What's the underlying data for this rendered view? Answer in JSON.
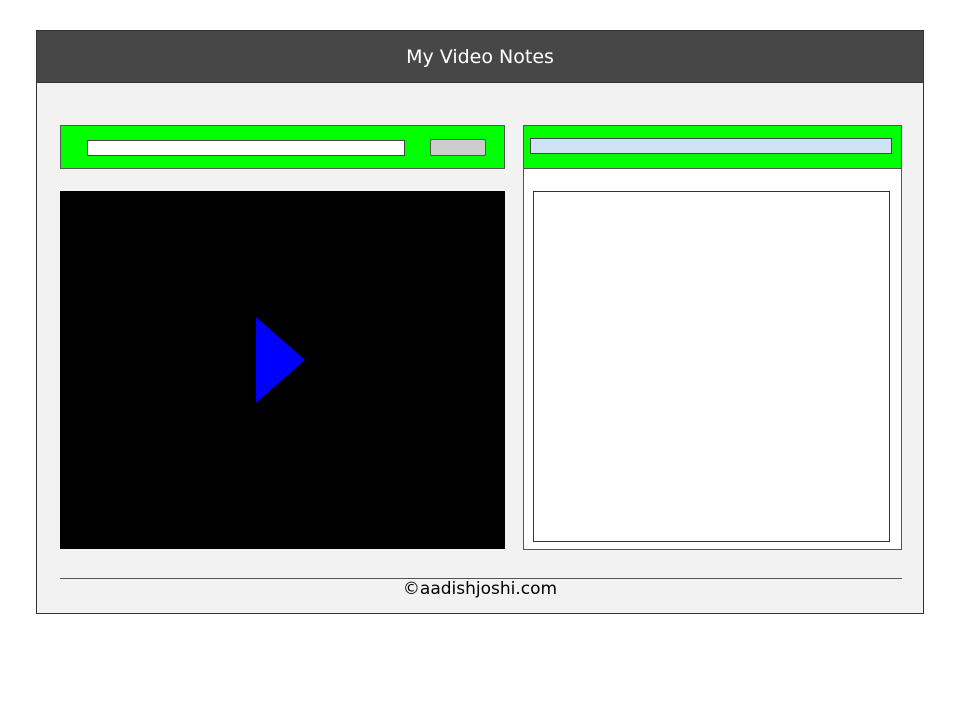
{
  "header": {
    "title": "My Video Notes"
  },
  "video_url_bar": {
    "input_value": "",
    "input_placeholder": "",
    "button_label": ""
  },
  "video_player": {
    "play_icon": "play-icon"
  },
  "notes_panel": {
    "title_value": "",
    "title_placeholder": "",
    "body_value": "",
    "body_placeholder": ""
  },
  "footer": {
    "copyright": "©aadishjoshi.com"
  },
  "colors": {
    "header_bg": "#474747",
    "toolbar_green": "#00ff00",
    "play_blue": "#0000ff",
    "notes_title_bg": "#cfe2f3",
    "video_bg": "#000000"
  }
}
